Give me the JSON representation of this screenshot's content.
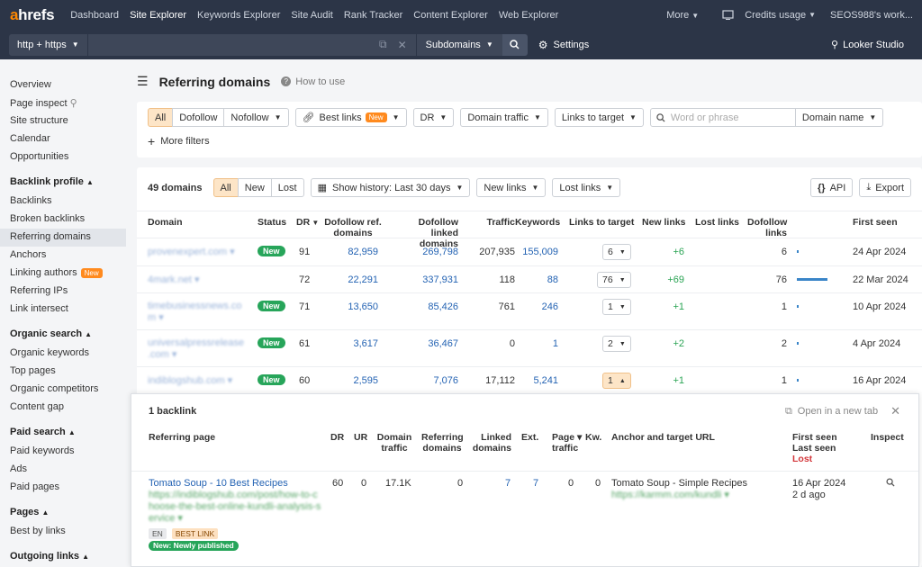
{
  "nav": {
    "logo_a": "a",
    "logo_rest": "hrefs",
    "items": [
      "Dashboard",
      "Site Explorer",
      "Keywords Explorer",
      "Site Audit",
      "Rank Tracker",
      "Content Explorer",
      "Web Explorer"
    ],
    "more": "More",
    "credits": "Credits usage",
    "account": "SEOS988's work..."
  },
  "urlbar": {
    "protocol": "http + https",
    "mode": "Subdomains",
    "settings": "Settings",
    "looker": "Looker Studio"
  },
  "sidebar": {
    "top": [
      "Overview",
      "Page inspect",
      "Site structure",
      "Calendar",
      "Opportunities"
    ],
    "backlink_head": "Backlink profile",
    "backlink": [
      "Backlinks",
      "Broken backlinks",
      "Referring domains",
      "Anchors",
      "Linking authors",
      "Referring IPs",
      "Link intersect"
    ],
    "new_badge": "New",
    "organic_head": "Organic search",
    "organic": [
      "Organic keywords",
      "Top pages",
      "Organic competitors",
      "Content gap"
    ],
    "paid_head": "Paid search",
    "paid": [
      "Paid keywords",
      "Ads",
      "Paid pages"
    ],
    "pages_head": "Pages",
    "pages": [
      "Best by links"
    ],
    "outgoing_head": "Outgoing links"
  },
  "header": {
    "title": "Referring domains",
    "how_to": "How to use"
  },
  "filters": {
    "all": "All",
    "dofollow": "Dofollow",
    "nofollow": "Nofollow",
    "best_links": "Best links",
    "best_badge": "New",
    "dr": "DR",
    "domain_traffic": "Domain traffic",
    "links_to_target": "Links to target",
    "word_placeholder": "Word or phrase",
    "domain_name": "Domain name",
    "more_filters": "More filters"
  },
  "toolbar": {
    "count": "49 domains",
    "all": "All",
    "new": "New",
    "lost": "Lost",
    "history": "Show history: Last 30 days",
    "new_links": "New links",
    "lost_links": "Lost links",
    "api": "API",
    "export": "Export"
  },
  "table": {
    "headers": {
      "domain": "Domain",
      "status": "Status",
      "dr": "DR",
      "dofollow_ref_1": "Dofollow ref.",
      "dofollow_ref_2": "domains",
      "dofollow_linked_1": "Dofollow linked",
      "dofollow_linked_2": "domains",
      "traffic": "Traffic",
      "keywords": "Keywords",
      "links_to_target": "Links to target",
      "new_links": "New links",
      "lost_links": "Lost links",
      "dofollow_links_1": "Dofollow",
      "dofollow_links_2": "links",
      "first_seen": "First seen"
    },
    "rows": [
      {
        "domain": "provenexpert.com ▾",
        "domain2": "",
        "status": "New",
        "dr": "91",
        "ref": "82,959",
        "linked": "269,798",
        "traffic": "207,935",
        "keywords": "155,009",
        "ltt": "6",
        "new_links": "+6",
        "dofollow": "6",
        "bar": 0.04,
        "first_seen": "24 Apr 2024"
      },
      {
        "domain": "4mark.net ▾",
        "domain2": "",
        "status": "",
        "dr": "72",
        "ref": "22,291",
        "linked": "337,931",
        "traffic": "118",
        "keywords": "88",
        "ltt": "76",
        "new_links": "+69",
        "dofollow": "76",
        "bar": 0.55,
        "first_seen": "22 Mar 2024"
      },
      {
        "domain": "timebusinessnews.co",
        "domain2": "m ▾",
        "status": "New",
        "dr": "71",
        "ref": "13,650",
        "linked": "85,426",
        "traffic": "761",
        "keywords": "246",
        "ltt": "1",
        "new_links": "+1",
        "dofollow": "1",
        "bar": 0.01,
        "first_seen": "10 Apr 2024"
      },
      {
        "domain": "universalpressrelease",
        "domain2": ".com ▾",
        "status": "New",
        "dr": "61",
        "ref": "3,617",
        "linked": "36,467",
        "traffic": "0",
        "keywords": "1",
        "ltt": "2",
        "new_links": "+2",
        "dofollow": "2",
        "bar": 0.02,
        "first_seen": "4 Apr 2024"
      },
      {
        "domain": "indiblogshub.com ▾",
        "domain2": "",
        "status": "New",
        "dr": "60",
        "ref": "2,595",
        "linked": "7,076",
        "traffic": "17,112",
        "keywords": "5,241",
        "ltt": "1",
        "new_links": "+1",
        "dofollow": "1",
        "bar": 0.01,
        "first_seen": "16 Apr 2024"
      }
    ]
  },
  "backlink": {
    "title": "1 backlink",
    "open_new_tab": "Open in a new tab",
    "headers": {
      "ref_page": "Referring page",
      "dr": "DR",
      "ur": "UR",
      "domain_traffic_1": "Domain",
      "domain_traffic_2": "traffic",
      "ref_domains_1": "Referring",
      "ref_domains_2": "domains",
      "linked_domains_1": "Linked",
      "linked_domains_2": "domains",
      "ext": "Ext.",
      "page_traffic_1": "Page ▾",
      "page_traffic_2": "traffic",
      "kw": "Kw.",
      "anchor": "Anchor and target URL",
      "first_seen": "First seen",
      "last_seen": "Last seen",
      "lost": "Lost",
      "inspect": "Inspect"
    },
    "row": {
      "title": "Tomato Soup - 10 Best Recipes",
      "url1": "https://indiblogshub.com/post/how-to-c",
      "url2": "hoose-the-best-online-kundli-analysis-s",
      "url3": "ervice ▾",
      "lang": "EN",
      "best": "BEST LINK",
      "new_tag": "New: Newly published",
      "dr": "60",
      "ur": "0",
      "domain_traffic": "17.1K",
      "ref_domains": "0",
      "linked_domains": "7",
      "ext": "7",
      "page_traffic": "0",
      "kw": "0",
      "anchor": "Tomato Soup - Simple Recipes",
      "target": "https://karmm.com/kundli ▾",
      "first_seen": "16 Apr 2024",
      "last_seen": "2 d ago"
    }
  }
}
